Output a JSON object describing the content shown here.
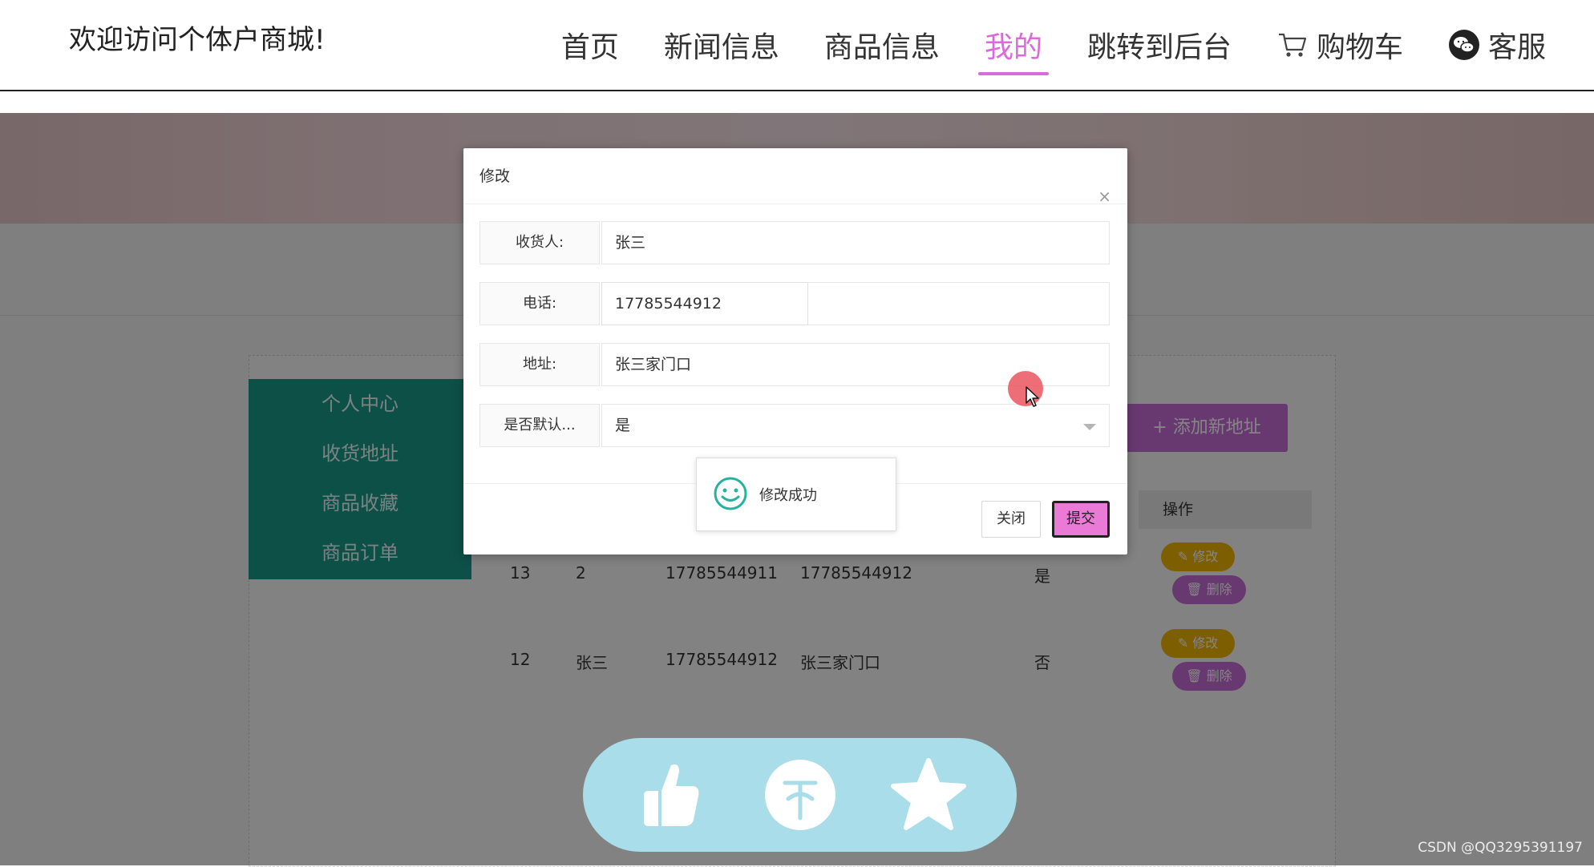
{
  "header": {
    "site_title": "欢迎访问个体户商城!",
    "nav": [
      {
        "label": "首页"
      },
      {
        "label": "新闻信息"
      },
      {
        "label": "商品信息"
      },
      {
        "label": "我的"
      },
      {
        "label": "跳转到后台"
      },
      {
        "label": "购物车",
        "icon": "cart-icon"
      },
      {
        "label": "客服",
        "icon": "wechat-icon"
      }
    ],
    "active": "我的"
  },
  "sidebar": {
    "items": [
      {
        "label": "个人中心"
      },
      {
        "label": "收货地址"
      },
      {
        "label": "商品收藏"
      },
      {
        "label": "商品订单"
      }
    ]
  },
  "address_panel": {
    "add_button": "添加新地址",
    "ops_header": "操作",
    "rows": [
      {
        "id": "13",
        "name": "2",
        "phone": "17785544911",
        "address": "17785544912",
        "default": "是",
        "edit": "修改",
        "delete": "删除"
      },
      {
        "id": "12",
        "name": "张三",
        "phone": "17785544912",
        "address": "张三家门口",
        "default": "否",
        "edit": "修改",
        "delete": "删除"
      }
    ]
  },
  "dialog": {
    "title": "修改",
    "close_symbol": "×",
    "fields": {
      "recipient": {
        "label": "收货人:",
        "value": "张三"
      },
      "phone": {
        "label": "电话:",
        "value": "17785544912"
      },
      "address": {
        "label": "地址:",
        "value": "张三家门口"
      },
      "is_default": {
        "label": "是否默认...",
        "value": "是"
      }
    },
    "close_button": "关闭",
    "submit_button": "提交"
  },
  "toast": {
    "message": "修改成功"
  },
  "fab": {
    "icons": [
      "thumbs-up-icon",
      "coin-icon",
      "star-icon"
    ]
  },
  "watermark": "CSDN @QQ3295391197",
  "colors": {
    "accent": "#d96bd8",
    "sidebar": "#1a9a8a",
    "fab_bg": "#a8dde9",
    "edit": "#f0b400",
    "delete": "#c76bd6"
  }
}
